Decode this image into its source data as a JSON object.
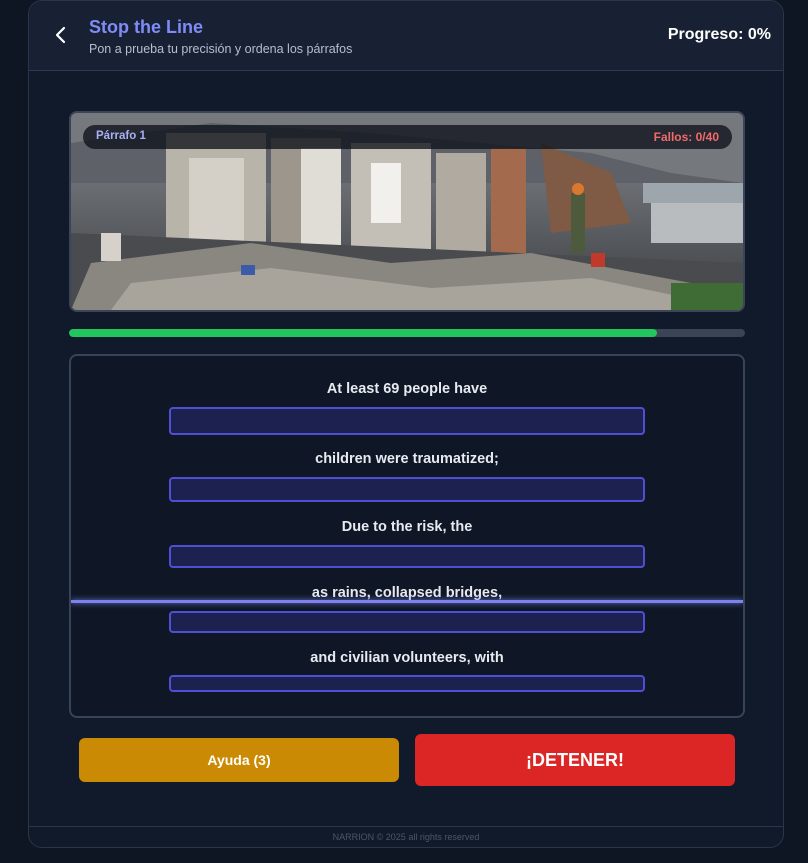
{
  "header": {
    "back_icon": "chevron-left-icon",
    "title": "Stop the Line",
    "subtitle": "Pon a prueba tu precisión y ordena los párrafos",
    "progress": "Progreso: 0%",
    "progress_value": 0
  },
  "banner": {
    "paragraph_label": "Párrafo 1",
    "fails": "Fallos: 0/40"
  },
  "level": {
    "fraction": 0.87
  },
  "rows": [
    {
      "text": "At least 69 people have"
    },
    {
      "text": "children were traumatized;"
    },
    {
      "text": "Due to the risk, the"
    },
    {
      "text": "as rains, collapsed bridges,"
    },
    {
      "text": "and civilian volunteers, with"
    }
  ],
  "buttons": {
    "help": "Ayuda (3)",
    "stop": "¡DETENER!"
  },
  "footer": {
    "text": "NARRION © 2025 all rights reserved"
  },
  "colors": {
    "accent": "#7f8cf7",
    "success": "#22c55e",
    "danger": "#dc2626",
    "warning": "#ca8a04",
    "fail_text": "#f06b6b"
  }
}
